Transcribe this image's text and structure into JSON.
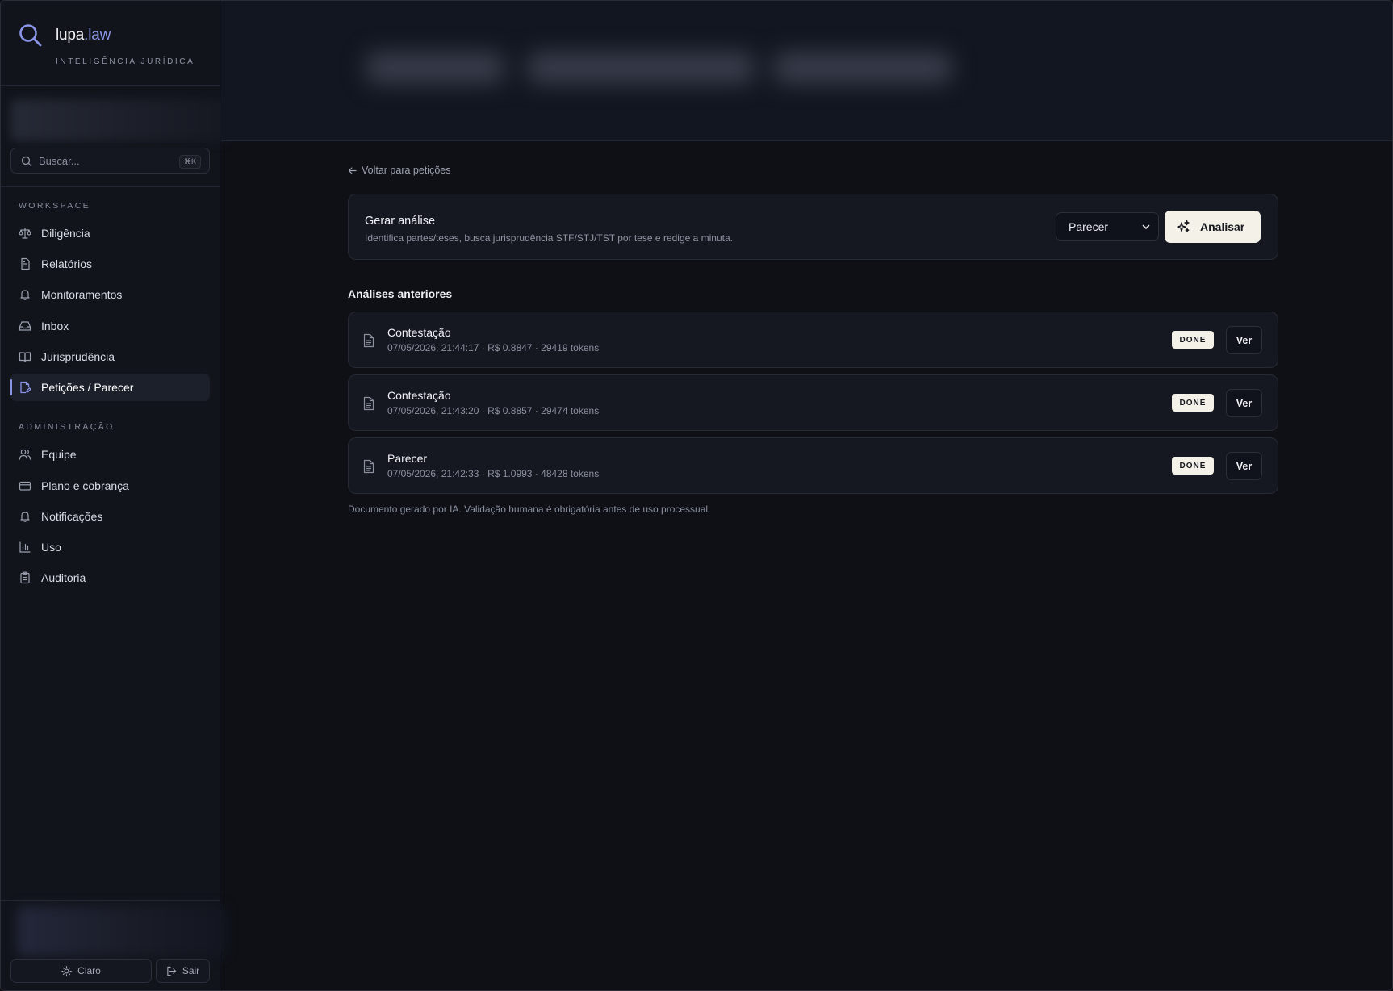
{
  "brand": {
    "name_main": "lupa",
    "name_tld": ".law",
    "subtitle": "INTELIGÊNCIA JURÍDICA",
    "accent_color": "#8b95e8"
  },
  "search": {
    "placeholder": "Buscar...",
    "shortcut": "⌘K",
    "icon": "search-icon"
  },
  "sidebar": {
    "workspace_label": "WORKSPACE",
    "workspace_items": [
      {
        "label": "Diligência",
        "icon": "scale-icon"
      },
      {
        "label": "Relatórios",
        "icon": "file-text-icon"
      },
      {
        "label": "Monitoramentos",
        "icon": "bell-icon"
      },
      {
        "label": "Inbox",
        "icon": "inbox-icon"
      },
      {
        "label": "Jurisprudência",
        "icon": "book-icon"
      },
      {
        "label": "Petições / Parecer",
        "icon": "file-pen-icon",
        "active": true
      }
    ],
    "admin_label": "ADMINISTRAÇÃO",
    "admin_items": [
      {
        "label": "Equipe",
        "icon": "users-icon"
      },
      {
        "label": "Plano e cobrança",
        "icon": "credit-card-icon"
      },
      {
        "label": "Notificações",
        "icon": "bell-icon"
      },
      {
        "label": "Uso",
        "icon": "bar-chart-icon"
      },
      {
        "label": "Auditoria",
        "icon": "clipboard-icon"
      }
    ],
    "footer": {
      "theme_label": "Claro",
      "logout_label": "Sair"
    }
  },
  "main": {
    "back_label": "Voltar para petições",
    "generate": {
      "title": "Gerar análise",
      "description": "Identifica partes/teses, busca jurisprudência STF/STJ/TST por tese e redige a minuta.",
      "type_selected": "Parecer",
      "action_label": "Analisar"
    },
    "previous_title": "Análises anteriores",
    "analyses": [
      {
        "name": "Contestação",
        "meta": "07/05/2026, 21:44:17 · R$ 0.8847 · 29419 tokens",
        "status": "DONE",
        "action": "Ver"
      },
      {
        "name": "Contestação",
        "meta": "07/05/2026, 21:43:20 · R$ 0.8857 · 29474 tokens",
        "status": "DONE",
        "action": "Ver"
      },
      {
        "name": "Parecer",
        "meta": "07/05/2026, 21:42:33 · R$ 1.0993 · 48428 tokens",
        "status": "DONE",
        "action": "Ver"
      }
    ],
    "disclaimer": "Documento gerado por IA. Validação humana é obrigatória antes de uso processual."
  }
}
